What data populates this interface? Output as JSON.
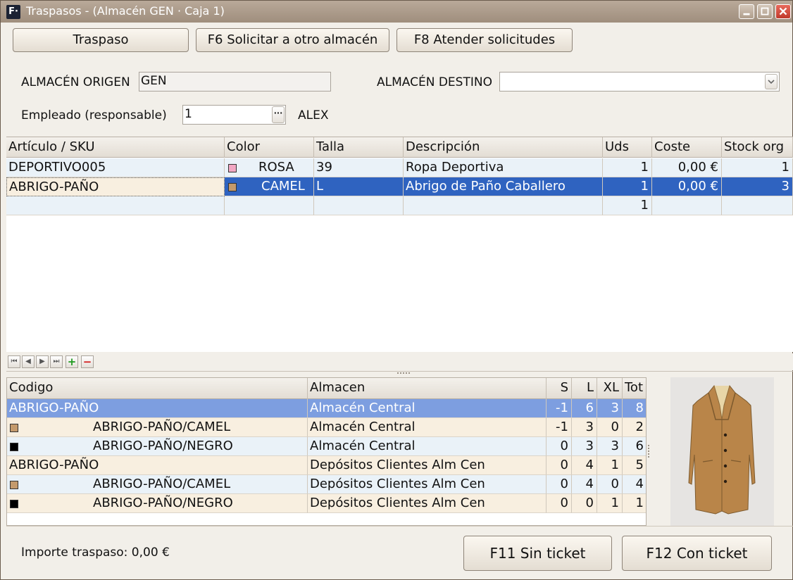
{
  "window": {
    "title": "Traspasos - (Almacén GEN · Caja 1)",
    "app_icon_text": "F·"
  },
  "toolbar": {
    "traspaso_label": "Traspaso",
    "solicitar_label": "F6 Solicitar a otro almacén",
    "atender_label": "F8 Atender solicitudes"
  },
  "form": {
    "origen_label": "ALMACÉN ORIGEN",
    "origen_value": "GEN",
    "destino_label": "ALMACÉN DESTINO",
    "destino_value": "",
    "empleado_label": "Empleado (responsable)",
    "empleado_value": "1",
    "empleado_name": "ALEX",
    "ellipsis": "···"
  },
  "lines_grid": {
    "columns": [
      "Artículo / SKU",
      "Color",
      "Talla",
      "Descripción",
      "Uds",
      "Coste",
      "Stock org"
    ],
    "rows": [
      {
        "sku": "DEPORTIVO005",
        "color": "ROSA",
        "color_hex": "#f2a7c3",
        "talla": "39",
        "descripcion": "Ropa Deportiva",
        "uds": "1",
        "coste": "0,00 €",
        "stock": "1"
      },
      {
        "sku": "ABRIGO-PAÑO",
        "color": "CAMEL",
        "color_hex": "#c49a6c",
        "talla": "L",
        "descripcion": "Abrigo de Paño Caballero",
        "uds": "1",
        "coste": "0,00 €",
        "stock": "3"
      },
      {
        "sku": "",
        "color": "",
        "color_hex": "",
        "talla": "",
        "descripcion": "",
        "uds": "1",
        "coste": "",
        "stock": ""
      }
    ]
  },
  "nav": {
    "first": "⏮",
    "prev": "◀",
    "next": "▶",
    "last": "⏭",
    "add": "+",
    "remove": "−"
  },
  "stock_grid": {
    "columns": [
      "Codigo",
      "Almacen",
      "S",
      "L",
      "XL",
      "Tot"
    ],
    "rows": [
      {
        "codigo": "ABRIGO-PAÑO",
        "almacen": "Almacén Central",
        "s": "-1",
        "l": "6",
        "xl": "3",
        "tot": "8",
        "swatch": ""
      },
      {
        "codigo": "ABRIGO-PAÑO/CAMEL",
        "almacen": "Almacén Central",
        "s": "-1",
        "l": "3",
        "xl": "0",
        "tot": "2",
        "swatch": "#c49a6c"
      },
      {
        "codigo": "ABRIGO-PAÑO/NEGRO",
        "almacen": "Almacén Central",
        "s": "0",
        "l": "3",
        "xl": "3",
        "tot": "6",
        "swatch": "#000000"
      },
      {
        "codigo": "ABRIGO-PAÑO",
        "almacen": "Depósitos Clientes Alm Cen",
        "s": "0",
        "l": "4",
        "xl": "1",
        "tot": "5",
        "swatch": ""
      },
      {
        "codigo": "ABRIGO-PAÑO/CAMEL",
        "almacen": "Depósitos Clientes Alm Cen",
        "s": "0",
        "l": "4",
        "xl": "0",
        "tot": "4",
        "swatch": "#c49a6c"
      },
      {
        "codigo": "ABRIGO-PAÑO/NEGRO",
        "almacen": "Depósitos Clientes Alm Cen",
        "s": "0",
        "l": "0",
        "xl": "1",
        "tot": "1",
        "swatch": "#000000"
      }
    ]
  },
  "footer": {
    "importe_label": "Importe traspaso: 0,00 €",
    "sin_ticket_label": "F11 Sin ticket",
    "con_ticket_label": "F12 Con ticket"
  },
  "colors": {
    "selection": "#2f63c0",
    "selection_light": "#7d9ee0",
    "coat": "#b98549"
  }
}
